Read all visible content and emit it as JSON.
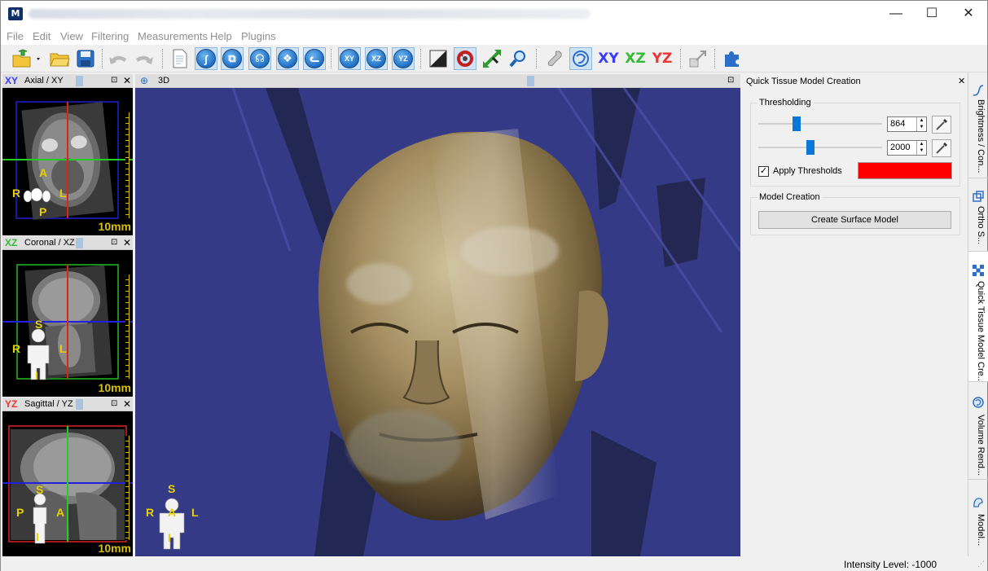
{
  "window": {
    "controls": {
      "minimize": "—",
      "maximize": "☐",
      "close": "✕"
    }
  },
  "menu": [
    "File",
    "Edit",
    "View",
    "Filtering",
    "Measurements",
    "Help",
    "Plugins"
  ],
  "toolbar": {
    "axis_buttons": [
      "XY",
      "XZ",
      "YZ"
    ],
    "axis_colors": {
      "xy": "#3a3aff",
      "xz": "#33bb33",
      "yz": "#ee3333"
    },
    "small_bubbles": [
      "XY",
      "XZ",
      "YZ"
    ]
  },
  "views": {
    "axial": {
      "axis": "XY",
      "label": "Axial / XY",
      "scale": "10mm",
      "orientation": {
        "top": "A",
        "left": "R",
        "right": "L",
        "bottom": "P"
      }
    },
    "coronal": {
      "axis": "XZ",
      "label": "Coronal / XZ",
      "scale": "10mm",
      "orientation": {
        "top": "S",
        "left": "R",
        "right": "L",
        "bottom": "I"
      }
    },
    "sagittal": {
      "axis": "YZ",
      "label": "Sagittal / YZ",
      "scale": "10mm",
      "orientation": {
        "top": "S",
        "left": "P",
        "right": "A",
        "bottom": "I"
      }
    },
    "three_d": {
      "label": "3D",
      "orientation": {
        "top": "S",
        "left": "R",
        "center": "A",
        "right": "L",
        "bottom": "I"
      }
    }
  },
  "panel": {
    "title": "Quick Tissue Model Creation",
    "close": "✕",
    "thresholding": {
      "title": "Thresholding",
      "lower_value": "864",
      "upper_value": "2000",
      "lower_position": 0.31,
      "upper_position": 0.42,
      "apply_label": "Apply Thresholds",
      "apply_checked": true,
      "color": "#ff0000"
    },
    "model_creation": {
      "title": "Model Creation",
      "button": "Create Surface Model"
    }
  },
  "side_tabs": [
    {
      "label": "Brightness / Con...",
      "icon": "brightness-curve-icon"
    },
    {
      "label": "Ortho S...",
      "icon": "ortho-slices-icon"
    },
    {
      "label": "Quick Tissue Model Cre...",
      "icon": "quick-tissue-icon"
    },
    {
      "label": "Volume Rend...",
      "icon": "volume-rendering-icon"
    },
    {
      "label": "Model...",
      "icon": "model-icon"
    }
  ],
  "status": {
    "intensity": "Intensity Level: -1000"
  }
}
